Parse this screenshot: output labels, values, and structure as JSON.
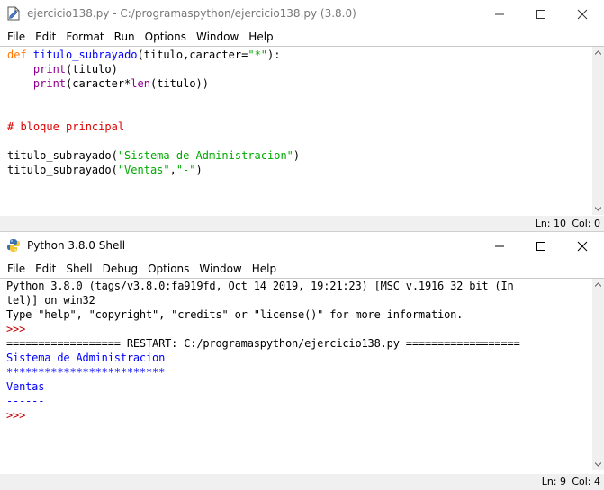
{
  "editor": {
    "title": "ejercicio138.py - C:/programaspython/ejercicio138.py (3.8.0)",
    "menu": [
      "File",
      "Edit",
      "Format",
      "Run",
      "Options",
      "Window",
      "Help"
    ],
    "code": {
      "l1_kw": "def",
      "l1_name": "titulo_subrayado",
      "l1_params": "(titulo,caracter=",
      "l1_str": "\"*\"",
      "l1_end": "):",
      "l2_indent": "    ",
      "l2_fn": "print",
      "l2_rest": "(titulo)",
      "l3_indent": "    ",
      "l3_fn": "print",
      "l3_mid": "(caracter*",
      "l3_fn2": "len",
      "l3_end": "(titulo))",
      "l6_comment": "# bloque principal",
      "l8_call": "titulo_subrayado(",
      "l8_str": "\"Sistema de Administracion\"",
      "l8_end": ")",
      "l9_call": "titulo_subrayado(",
      "l9_str1": "\"Ventas\"",
      "l9_comma": ",",
      "l9_str2": "\"-\"",
      "l9_end": ")"
    },
    "status": {
      "ln": "Ln: 10",
      "col": "Col: 0"
    }
  },
  "shell": {
    "title": "Python 3.8.0 Shell",
    "menu": [
      "File",
      "Edit",
      "Shell",
      "Debug",
      "Options",
      "Window",
      "Help"
    ],
    "lines": {
      "banner1": "Python 3.8.0 (tags/v3.8.0:fa919fd, Oct 14 2019, 19:21:23) [MSC v.1916 32 bit (In",
      "banner2": "tel)] on win32",
      "banner3": "Type \"help\", \"copyright\", \"credits\" or \"license()\" for more information.",
      "prompt1": ">>>",
      "restart": "================== RESTART: C:/programaspython/ejercicio138.py ==================",
      "out1": "Sistema de Administracion",
      "out2": "*************************",
      "out3": "Ventas",
      "out4": "------",
      "prompt2": ">>>"
    },
    "status": {
      "ln": "Ln: 9",
      "col": "Col: 4"
    }
  },
  "icons": [
    "idle-file-icon",
    "python-shell-icon",
    "minimize-icon",
    "maximize-icon",
    "close-icon",
    "scroll-up-icon",
    "scroll-down-icon"
  ]
}
